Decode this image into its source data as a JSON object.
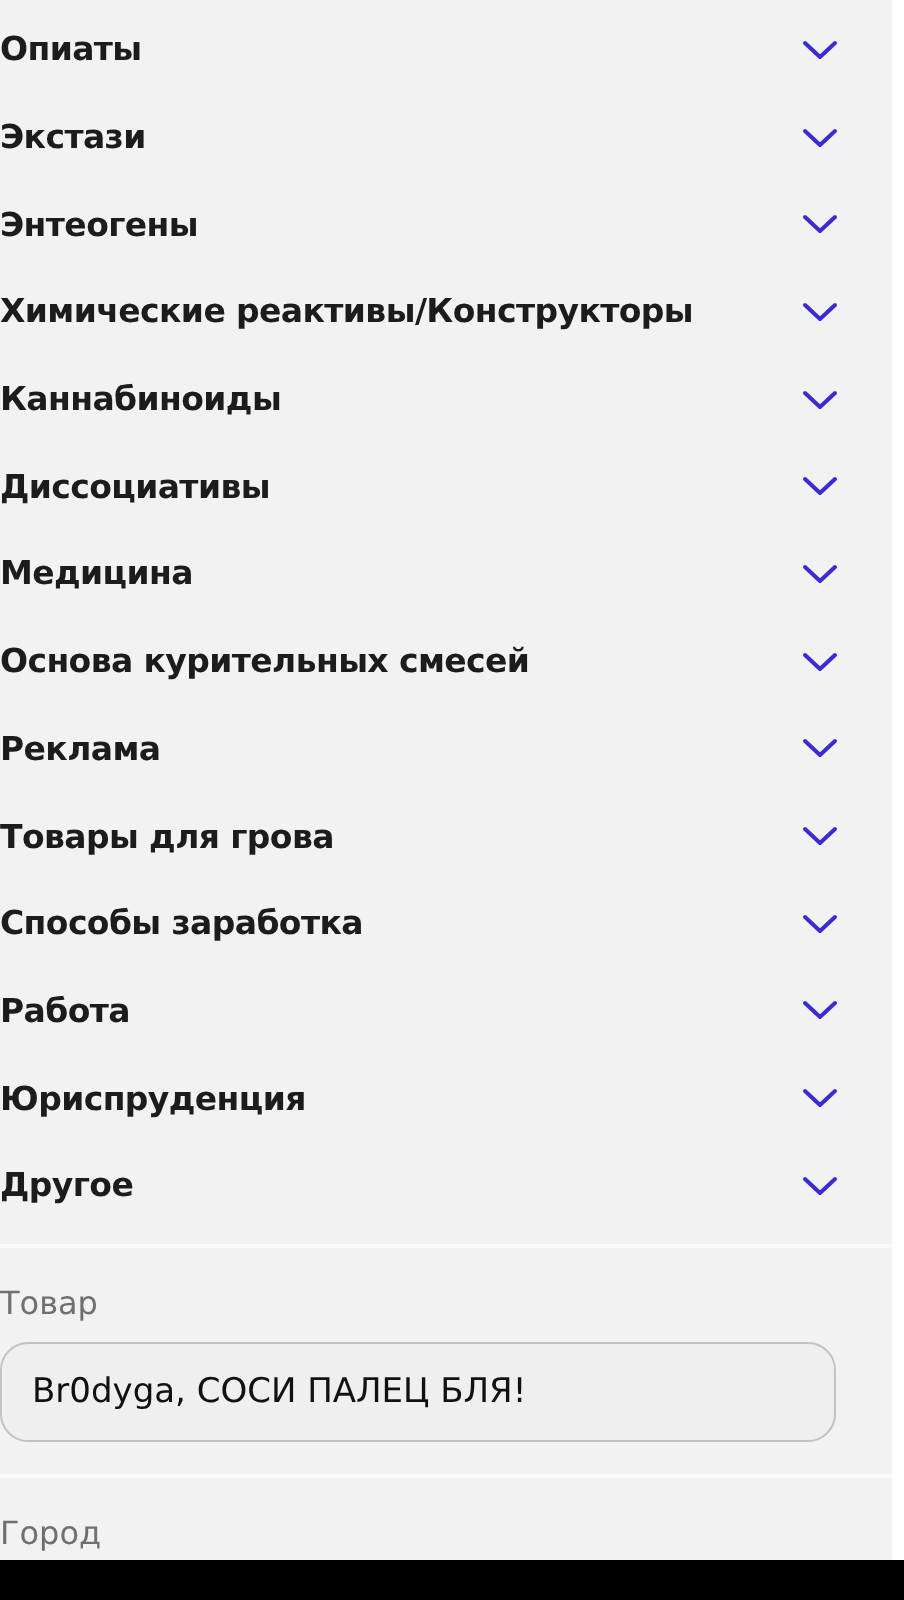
{
  "categories": [
    {
      "label": "Опиаты",
      "expanded": false
    },
    {
      "label": "Экстази",
      "expanded": false
    },
    {
      "label": "Энтеогены",
      "expanded": false
    },
    {
      "label": "Химические реактивы/Конструкторы",
      "expanded": false
    },
    {
      "label": "Каннабиноиды",
      "expanded": false
    },
    {
      "label": "Диссоциативы",
      "expanded": false
    },
    {
      "label": "Медицина",
      "expanded": false
    },
    {
      "label": "Основа курительных смесей",
      "expanded": false
    },
    {
      "label": "Реклама",
      "expanded": false
    },
    {
      "label": "Товары для грова",
      "expanded": false
    },
    {
      "label": "Способы заработка",
      "expanded": false
    },
    {
      "label": "Работа",
      "expanded": false
    },
    {
      "label": "Юриспруденция",
      "expanded": false
    },
    {
      "label": "Другое",
      "expanded": false
    }
  ],
  "product": {
    "label": "Товар",
    "value": "Br0dyga, СОСИ ПАЛЕЦ БЛЯ!"
  },
  "city": {
    "label": "Город"
  }
}
